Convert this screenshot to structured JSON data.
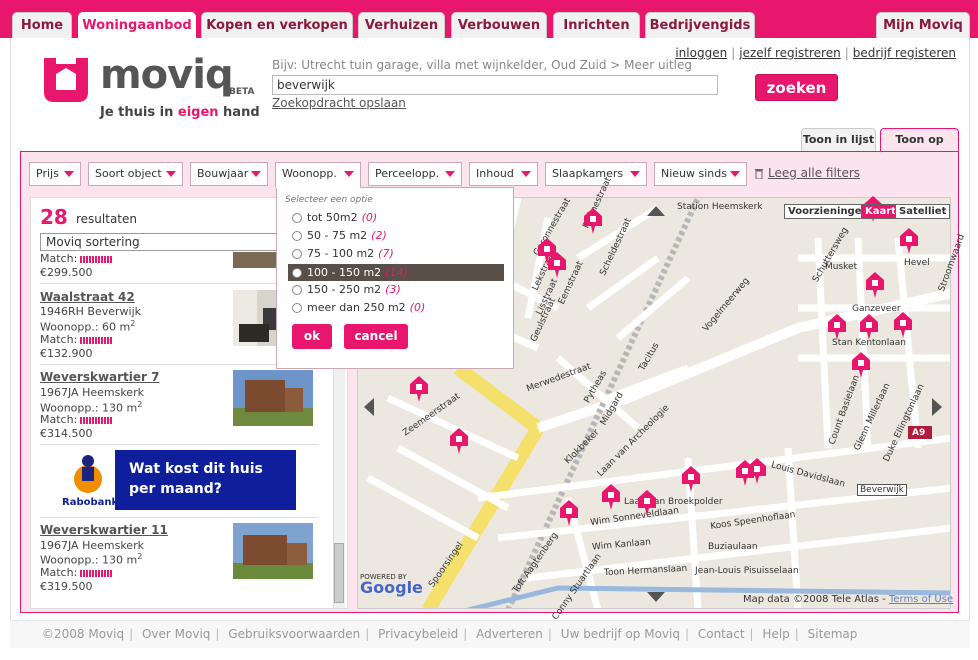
{
  "nav": {
    "tabs": [
      "Home",
      "Woningaanbod",
      "Kopen en verkopen",
      "Verhuizen",
      "Verbouwen",
      "Inrichten",
      "Bedrijvengids"
    ],
    "active_tab": "Woningaanbod",
    "mijn": "Mijn Moviq"
  },
  "brand": {
    "name": "moviq",
    "beta": "BETA",
    "slogan_pre": "Je thuis in ",
    "slogan_pink": "eigen",
    "slogan_post": " hand",
    "accent": "#e8166d"
  },
  "search": {
    "hint": "Bijv: Utrecht tuin garage, villa met wijnkelder, Oud Zuid > Meer uitleg",
    "value": "beverwijk",
    "save_label": "Zoekopdracht opslaan",
    "button": "zoeken"
  },
  "account": {
    "login": "inloggen",
    "register": "jezelf registreren",
    "business": "bedrijf registeren"
  },
  "views": {
    "list": "Toon in lijst",
    "map": "Toon op kaart"
  },
  "filters": {
    "items": [
      "Prijs",
      "Soort object",
      "Bouwjaar",
      "Woonopp.",
      "Perceelopp.",
      "Inhoud",
      "Slaapkamers",
      "Nieuw sinds"
    ],
    "clear": "Leeg alle filters"
  },
  "dropdown": {
    "title": "Selecteer een optie",
    "options": [
      {
        "label": "tot 50m2",
        "count": "(0)"
      },
      {
        "label": "50 - 75 m2",
        "count": "(2)"
      },
      {
        "label": "75 - 100 m2",
        "count": "(7)"
      },
      {
        "label": "100 - 150 m2",
        "count": "(14)"
      },
      {
        "label": "150 - 250 m2",
        "count": "(3)"
      },
      {
        "label": "meer dan 250 m2",
        "count": "(0)"
      }
    ],
    "ok": "ok",
    "cancel": "cancel"
  },
  "results": {
    "count": "28",
    "label": "resultaten",
    "sort": "Moviq sortering",
    "partial_match": "Match:",
    "partial_price": "€299.500",
    "items": [
      {
        "title": "Waalstraat 42",
        "city": "1946RH Beverwijk",
        "area": "Woonopp.: 60 m",
        "sup": "2",
        "match": "Match:",
        "price": "€132.900"
      },
      {
        "title": "Weverskwartier 7",
        "city": "1967JA Heemskerk",
        "area": "Woonopp.: 130 m",
        "sup": "2",
        "match": "Match:",
        "price": "€314.500"
      },
      {
        "title": "Weverskwartier 11",
        "city": "1967JA Heemskerk",
        "area": "Woonopp.: 130 m",
        "sup": "2",
        "match": "Match:",
        "price": "€319.500"
      }
    ]
  },
  "ad": {
    "line1": "Wat kost dit huis",
    "line2": "per maand?",
    "bank": "Rabobank"
  },
  "map": {
    "buttons": [
      "Voorzieningen",
      "Kaart",
      "Satelliet"
    ],
    "active": "Kaart",
    "attribution": "Map data ©2008 Tele Atlas -",
    "terms": "Terms of Use",
    "powered": "POWERED BY",
    "google": "Google",
    "streets": [
      "Garonnestraat",
      "Rhônestraat",
      "Scheldestraat",
      "Lekstraat",
      "Eemstraat",
      "Lisstraat",
      "Geulstraat",
      "Merwedestraat",
      "Pytheas",
      "Midgard",
      "Tacitus",
      "Vogelmeerweg",
      "Laan van Archeologie",
      "Klokbeker",
      "Spoorsingel",
      "Wim Sonneveldlaan",
      "Wim Kanlaan",
      "Toon Hermanslaan",
      "Jean-Louis Pisuisselaan",
      "Buziaulaan",
      "Koos Speenhoflaan",
      "Louis Davidslaan",
      "Duke Ellingtonlaan",
      "Glenn Millerlaan",
      "Count Basielaan",
      "Laan van Broekpolder",
      "Stan Kentonlaan",
      "Schuttersweg",
      "Musket",
      "Hevel",
      "Ganzeveer",
      "Stroomwaard",
      "Beverwijk",
      "A9",
      "Station Heemskerk",
      "Conny Stuartlaan",
      "Toft Aagtenberg",
      "Zeemeerstraat"
    ]
  },
  "footer": [
    "©2008 Moviq",
    "Over Moviq",
    "Gebruiksvoorwaarden",
    "Privacybeleid",
    "Adverteren",
    "Uw bedrijf op Moviq",
    "Contact",
    "Help",
    "Sitemap"
  ]
}
